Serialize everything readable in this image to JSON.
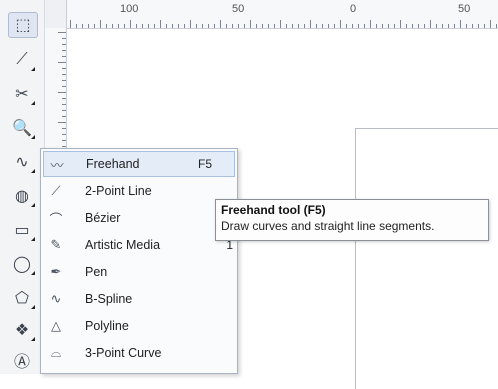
{
  "ruler": {
    "h_labels": [
      "100",
      "50",
      "0",
      "50"
    ]
  },
  "toolbox": {
    "tools": [
      {
        "name": "pick-tool-icon",
        "glyph": "⬚"
      },
      {
        "name": "shape-tool-icon",
        "glyph": "⟋"
      },
      {
        "name": "crop-tool-icon",
        "glyph": "✂"
      },
      {
        "name": "zoom-tool-icon",
        "glyph": "🔍"
      },
      {
        "name": "curve-tool-icon",
        "glyph": "∿"
      },
      {
        "name": "smart-fill-icon",
        "glyph": "◍"
      },
      {
        "name": "rectangle-tool-icon",
        "glyph": "▭"
      },
      {
        "name": "ellipse-tool-icon",
        "glyph": "◯"
      },
      {
        "name": "polygon-tool-icon",
        "glyph": "⬠"
      },
      {
        "name": "basic-shapes-icon",
        "glyph": "❖"
      },
      {
        "name": "text-tool-icon",
        "glyph": "Ⓐ"
      }
    ]
  },
  "flyout": {
    "items": [
      {
        "label": "Freehand",
        "shortcut": "F5",
        "icon": "freehand-icon",
        "glyph": "〰"
      },
      {
        "label": "2-Point Line",
        "shortcut": "",
        "icon": "two-point-line-icon",
        "glyph": "⟋"
      },
      {
        "label": "Bézier",
        "shortcut": "",
        "icon": "bezier-icon",
        "glyph": "⌒"
      },
      {
        "label": "Artistic Media",
        "shortcut": "1",
        "icon": "artistic-media-icon",
        "glyph": "✎"
      },
      {
        "label": "Pen",
        "shortcut": "",
        "icon": "pen-icon",
        "glyph": "✒"
      },
      {
        "label": "B-Spline",
        "shortcut": "",
        "icon": "b-spline-icon",
        "glyph": "∿"
      },
      {
        "label": "Polyline",
        "shortcut": "",
        "icon": "polyline-icon",
        "glyph": "△"
      },
      {
        "label": "3-Point Curve",
        "shortcut": "",
        "icon": "three-point-curve-icon",
        "glyph": "⌓"
      }
    ]
  },
  "tooltip": {
    "title": "Freehand tool (F5)",
    "description": "Draw curves and straight line segments."
  },
  "colors": {
    "highlight": "#e4ecf7",
    "border": "#a9b3c1"
  }
}
